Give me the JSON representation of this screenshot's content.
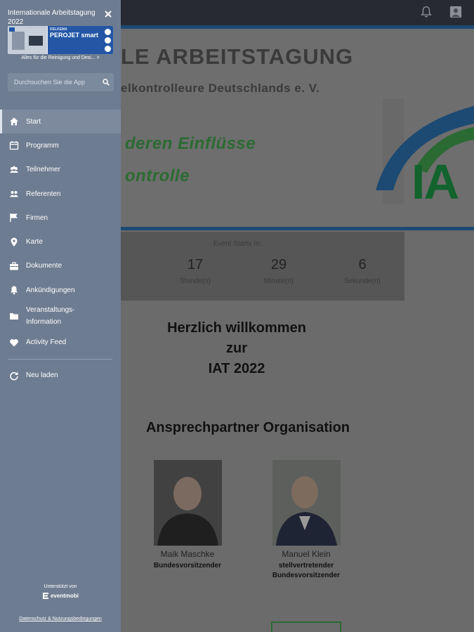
{
  "topbar": {
    "icons": [
      "bell-icon",
      "user-icon"
    ]
  },
  "banner": {
    "title": "LE ARBEITSTAGUNG",
    "subtitle": "elkontrolleure Deutschlands e. V.",
    "line1": "deren Einflüsse",
    "line2": "ontrolle",
    "logo_text": "IA"
  },
  "countdown": {
    "label": "Event Starts In:",
    "cells": [
      {
        "value": "",
        "unit": ""
      },
      {
        "value": "17",
        "unit": "Stunde(n)"
      },
      {
        "value": "29",
        "unit": "Minute(n)"
      },
      {
        "value": "6",
        "unit": "Sekunde(n)"
      }
    ]
  },
  "welcome": {
    "lines": [
      "Herzlich willkommen",
      "zur",
      "IAT 2022"
    ]
  },
  "contacts": {
    "title": "Ansprechpartner Organisation",
    "people": [
      {
        "name": "Maik Maschke",
        "role_lines": [
          "Bundesvorsitzender"
        ]
      },
      {
        "name": "Manuel Klein",
        "role_lines": [
          "stellvertretender",
          "Bundesvorsitzender"
        ]
      }
    ]
  },
  "drawer": {
    "app_title": "Internationale Arbeitstagung 2022",
    "ad": {
      "brand": "DELKEMA",
      "product": "PEROJET smart",
      "caption": "Alles für die Reinigung und Desi... >"
    },
    "search": {
      "placeholder": "Durchsuchen Sie die App"
    },
    "menu": [
      {
        "label": "Start",
        "icon": "home-icon",
        "active": true
      },
      {
        "label": "Programm",
        "icon": "calendar-icon"
      },
      {
        "label": "Teilnehmer",
        "icon": "people-icon"
      },
      {
        "label": "Referenten",
        "icon": "speakers-icon"
      },
      {
        "label": "Firmen",
        "icon": "flag-icon"
      },
      {
        "label": "Karte",
        "icon": "map-pin-icon"
      },
      {
        "label": "Dokumente",
        "icon": "briefcase-icon"
      },
      {
        "label": "Ankündigungen",
        "icon": "bell-icon"
      },
      {
        "label": "Veranstaltungs-Information",
        "icon": "folder-icon"
      },
      {
        "label": "Activity Feed",
        "icon": "heart-icon"
      }
    ],
    "reload": {
      "label": "Neu laden",
      "icon": "reload-icon"
    },
    "powered_label": "Unterstützt von",
    "powered_brand": "eventmobi",
    "privacy": "Datenschutz & Nutzungsbedingungen"
  }
}
